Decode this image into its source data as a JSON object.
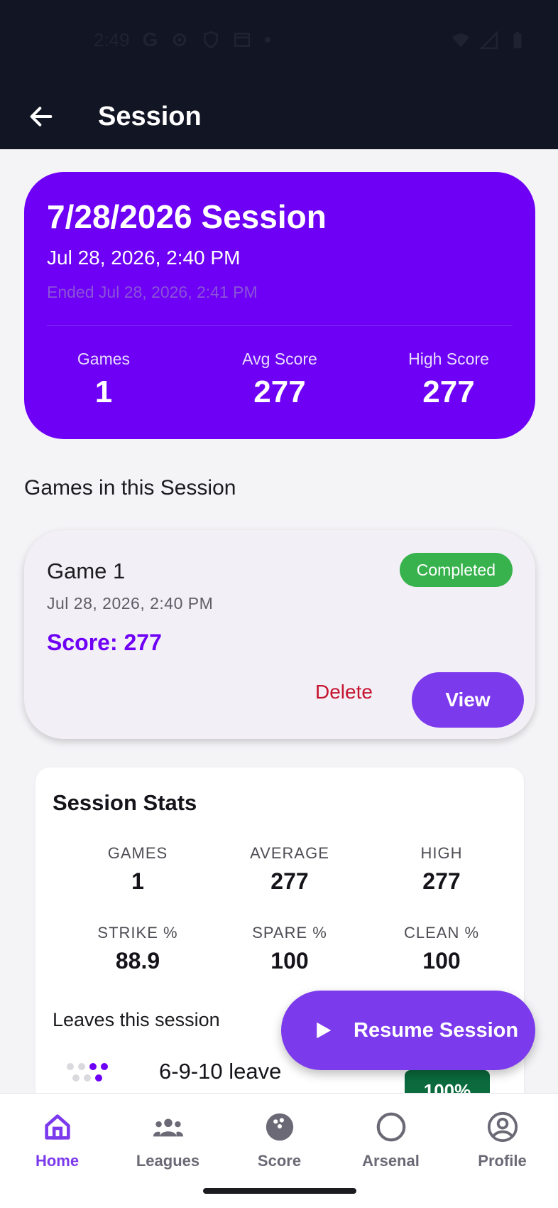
{
  "status_bar": {
    "time": "2:49",
    "g_label": "G"
  },
  "app_bar": {
    "title": "Session"
  },
  "hero": {
    "title": "7/28/2026 Session",
    "date": "Jul 28, 2026, 2:40 PM",
    "ended": "Ended Jul 28, 2026, 2:41 PM",
    "stats": [
      {
        "label": "Games",
        "value": "1"
      },
      {
        "label": "Avg Score",
        "value": "277"
      },
      {
        "label": "High Score",
        "value": "277"
      }
    ]
  },
  "games_section": {
    "heading": "Games in this Session"
  },
  "game_card": {
    "title": "Game 1",
    "status": "Completed",
    "date": "Jul 28, 2026, 2:40 PM",
    "score": "Score: 277",
    "delete_label": "Delete",
    "view_label": "View"
  },
  "session_stats": {
    "title": "Session Stats",
    "cells": [
      {
        "label": "GAMES",
        "value": "1"
      },
      {
        "label": "AVERAGE",
        "value": "277"
      },
      {
        "label": "HIGH",
        "value": "277"
      },
      {
        "label": "STRIKE %",
        "value": "88.9"
      },
      {
        "label": "SPARE %",
        "value": "100"
      },
      {
        "label": "CLEAN %",
        "value": "100"
      }
    ],
    "leaves_heading": "Leaves this session",
    "leaves": [
      {
        "label": "6-9-10 leave",
        "percent": "100%"
      }
    ]
  },
  "fab": {
    "label": "Resume Session",
    "icon": "play-icon"
  },
  "bottom_nav": {
    "items": [
      {
        "label": "Home",
        "icon": "home-icon",
        "active": true
      },
      {
        "label": "Leagues",
        "icon": "group-icon",
        "active": false
      },
      {
        "label": "Score",
        "icon": "bowling-ball-icon",
        "active": false
      },
      {
        "label": "Arsenal",
        "icon": "circle-icon",
        "active": false
      },
      {
        "label": "Profile",
        "icon": "account-circle-icon",
        "active": false
      }
    ]
  },
  "colors": {
    "primary": "#6d00f5",
    "accent": "#7c3aed",
    "success": "#37b24d",
    "danger": "#c4152f",
    "dark_bar": "#121524"
  }
}
